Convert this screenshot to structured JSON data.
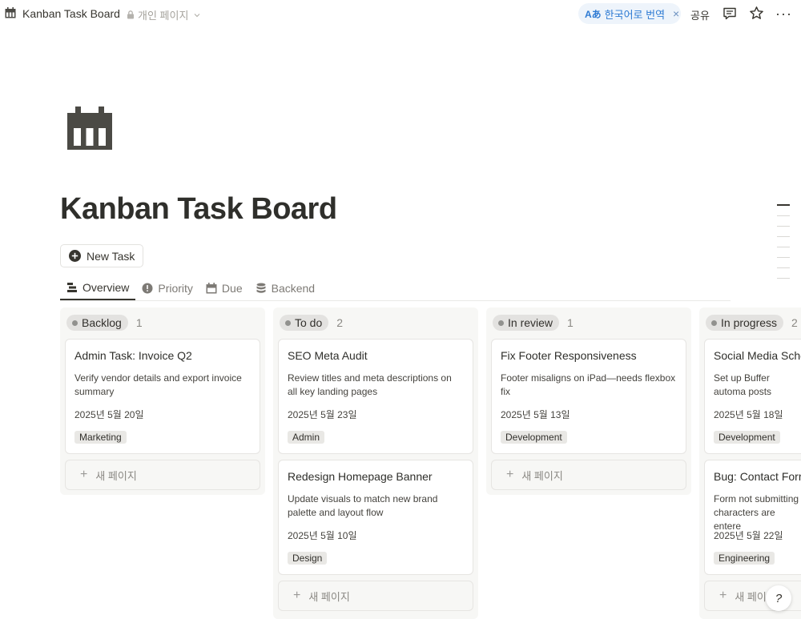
{
  "topbar": {
    "title": "Kanban Task Board",
    "private_label": "개인 페이지",
    "translate_badge": "Aあ",
    "translate_label": "한국어로 번역",
    "close_symbol": "×",
    "share_label": "공유",
    "more_symbol": "···"
  },
  "page": {
    "title": "Kanban Task Board",
    "new_task_label": "New Task"
  },
  "tabs": [
    {
      "label": "Overview",
      "icon": "board-icon",
      "active": true
    },
    {
      "label": "Priority",
      "icon": "alert-circle-icon",
      "active": false
    },
    {
      "label": "Due",
      "icon": "calendar-icon",
      "active": false
    },
    {
      "label": "Backend",
      "icon": "database-icon",
      "active": false
    }
  ],
  "columns": [
    {
      "status": "Backlog",
      "count": "1",
      "cards": [
        {
          "title": "Admin Task: Invoice Q2",
          "desc": "Verify vendor details and export invoice summary",
          "date": "2025년 5월 20일",
          "tag": "Marketing"
        }
      ],
      "add_label": "새 페이지"
    },
    {
      "status": "To do",
      "count": "2",
      "cards": [
        {
          "title": "SEO Meta Audit",
          "desc": "Review titles and meta descriptions on all key landing pages",
          "date": "2025년 5월 23일",
          "tag": "Admin"
        },
        {
          "title": "Redesign Homepage Banner",
          "desc": "Update visuals to match new brand palette and layout flow",
          "date": "2025년 5월 10일",
          "tag": "Design"
        }
      ],
      "add_label": "새 페이지"
    },
    {
      "status": "In review",
      "count": "1",
      "cards": [
        {
          "title": "Fix Footer Responsiveness",
          "desc": "Footer misaligns on iPad—needs flexbox fix",
          "date": "2025년 5월 13일",
          "tag": "Development"
        }
      ],
      "add_label": "새 페이지"
    },
    {
      "status": "In progress",
      "count": "2",
      "cards": [
        {
          "title": "Social Media Sche",
          "desc": "Set up Buffer automa posts",
          "date": "2025년 5월 18일",
          "tag": "Development"
        },
        {
          "title": "Bug: Contact Forr",
          "desc": "Form not submitting characters are entere",
          "date": "2025년 5월 22일",
          "tag": "Engineering"
        }
      ],
      "add_label": "새 페이지"
    }
  ],
  "colors": {
    "accent_blue": "#2f7bd3",
    "pill_gray": "#e3e2e0",
    "board_bg": "#f7f7f5"
  }
}
